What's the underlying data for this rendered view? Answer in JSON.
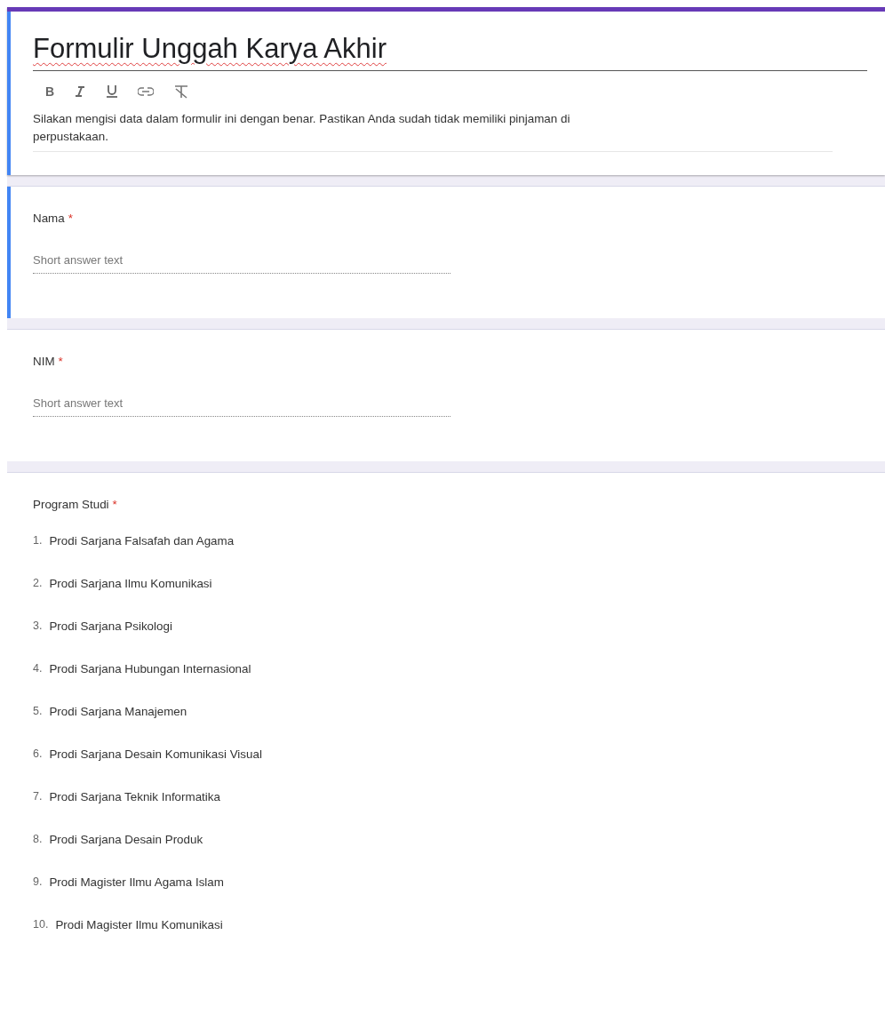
{
  "header": {
    "title": "Formulir Unggah Karya Akhir",
    "focused": true,
    "toolbar": [
      {
        "kind": "bold",
        "label": "B"
      },
      {
        "kind": "italic"
      },
      {
        "kind": "underline"
      },
      {
        "kind": "link"
      },
      {
        "kind": "clear"
      }
    ],
    "description": "Silakan mengisi data dalam formulir ini dengan benar. Pastikan Anda sudah tidak memiliki pinjaman di perpustakaan."
  },
  "questions": [
    {
      "kind": "short",
      "title": "Nama",
      "required": true,
      "required_mark": "*",
      "focused": true,
      "placeholder": "Short answer text"
    },
    {
      "kind": "short",
      "title": "NIM",
      "required": true,
      "required_mark": "*",
      "focused": false,
      "placeholder": "Short answer text"
    },
    {
      "kind": "list",
      "title": "Program Studi",
      "required": true,
      "required_mark": "*",
      "focused": false,
      "items": [
        {
          "number": "1.",
          "label": "Prodi Sarjana Falsafah dan Agama"
        },
        {
          "number": "2.",
          "label": "Prodi Sarjana Ilmu Komunikasi"
        },
        {
          "number": "3.",
          "label": "Prodi Sarjana Psikologi"
        },
        {
          "number": "4.",
          "label": "Prodi Sarjana Hubungan Internasional"
        },
        {
          "number": "5.",
          "label": "Prodi Sarjana Manajemen"
        },
        {
          "number": "6.",
          "label": "Prodi Sarjana Desain Komunikasi Visual"
        },
        {
          "number": "7.",
          "label": "Prodi Sarjana Teknik Informatika"
        },
        {
          "number": "8.",
          "label": "Prodi Sarjana Desain Produk"
        },
        {
          "number": "9.",
          "label": "Prodi Magister Ilmu Agama Islam"
        },
        {
          "number": "10.",
          "label": "Prodi Magister Ilmu Komunikasi"
        }
      ]
    }
  ]
}
